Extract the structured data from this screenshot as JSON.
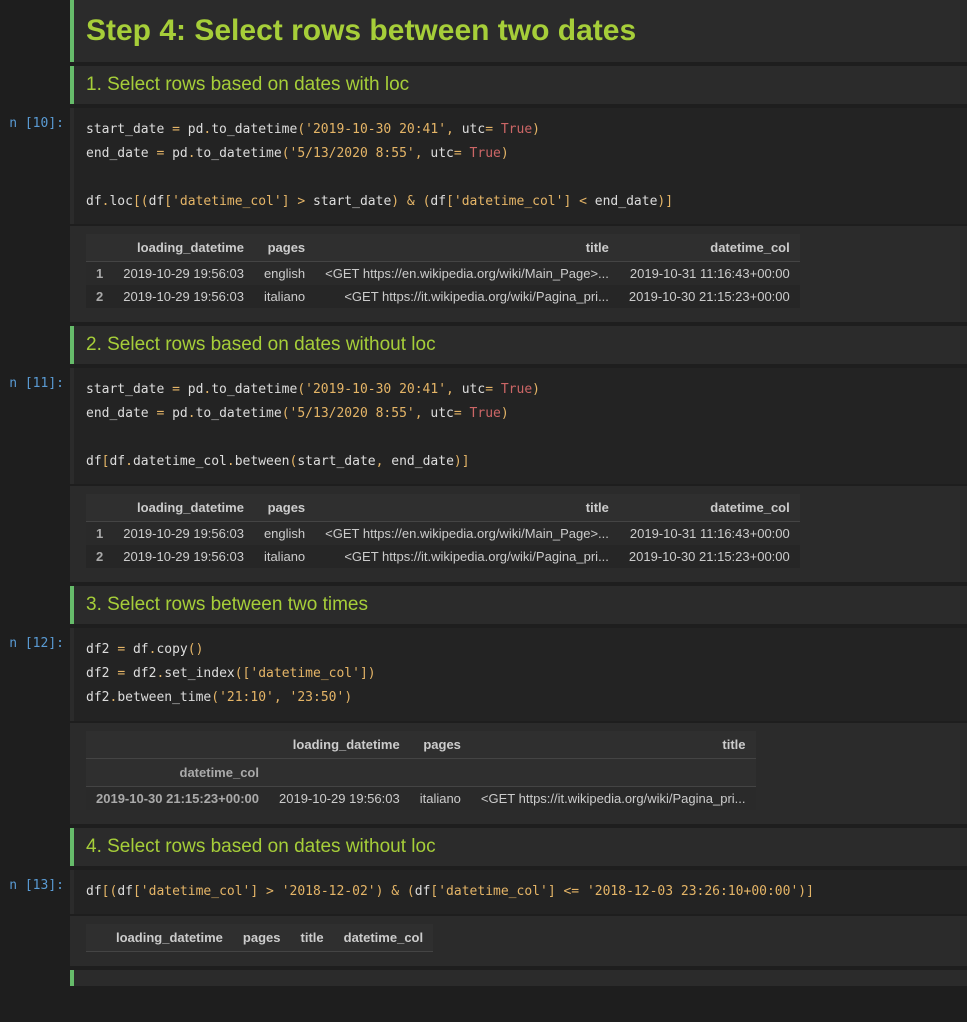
{
  "cells": [
    {
      "type": "md_h1",
      "text": "Step 4: Select rows between two dates"
    },
    {
      "type": "md_h3",
      "text": "1. Select rows based on dates with loc"
    },
    {
      "type": "code",
      "prompt": "n [10]:",
      "tokens": [
        [
          [
            "nm",
            "start_date "
          ],
          [
            "op",
            "="
          ],
          [
            "nm",
            " pd"
          ],
          [
            "op",
            "."
          ],
          [
            "nm",
            "to_datetime"
          ],
          [
            "op",
            "("
          ],
          [
            "str",
            "'2019-10-30 20:41'"
          ],
          [
            "op",
            ","
          ],
          [
            "nm",
            " utc"
          ],
          [
            "op",
            "= "
          ],
          [
            "key",
            "True"
          ],
          [
            "op",
            ")"
          ]
        ],
        [
          [
            "nm",
            "end_date "
          ],
          [
            "op",
            "="
          ],
          [
            "nm",
            " pd"
          ],
          [
            "op",
            "."
          ],
          [
            "nm",
            "to_datetime"
          ],
          [
            "op",
            "("
          ],
          [
            "str",
            "'5/13/2020 8:55'"
          ],
          [
            "op",
            ","
          ],
          [
            "nm",
            " utc"
          ],
          [
            "op",
            "= "
          ],
          [
            "key",
            "True"
          ],
          [
            "op",
            ")"
          ]
        ],
        [],
        [
          [
            "nm",
            "df"
          ],
          [
            "op",
            "."
          ],
          [
            "nm",
            "loc"
          ],
          [
            "op",
            "[("
          ],
          [
            "nm",
            "df"
          ],
          [
            "op",
            "["
          ],
          [
            "str",
            "'datetime_col'"
          ],
          [
            "op",
            "]"
          ],
          [
            "nm",
            " "
          ],
          [
            "op",
            ">"
          ],
          [
            "nm",
            " start_date"
          ],
          [
            "op",
            ")"
          ],
          [
            "nm",
            " "
          ],
          [
            "op",
            "&"
          ],
          [
            "nm",
            " "
          ],
          [
            "op",
            "("
          ],
          [
            "nm",
            "df"
          ],
          [
            "op",
            "["
          ],
          [
            "str",
            "'datetime_col'"
          ],
          [
            "op",
            "]"
          ],
          [
            "nm",
            " "
          ],
          [
            "op",
            "<"
          ],
          [
            "nm",
            " end_date"
          ],
          [
            "op",
            ")]"
          ]
        ]
      ],
      "output_table": {
        "index_name": "",
        "headers": [
          "loading_datetime",
          "pages",
          "title",
          "datetime_col"
        ],
        "rows": [
          {
            "idx": "1",
            "cells": [
              "2019-10-29 19:56:03",
              "english",
              "<GET https://en.wikipedia.org/wiki/Main_Page>...",
              "2019-10-31 11:16:43+00:00"
            ]
          },
          {
            "idx": "2",
            "cells": [
              "2019-10-29 19:56:03",
              "italiano",
              "<GET https://it.wikipedia.org/wiki/Pagina_pri...",
              "2019-10-30 21:15:23+00:00"
            ]
          }
        ]
      }
    },
    {
      "type": "md_h3",
      "text": "2. Select rows based on dates without loc"
    },
    {
      "type": "code",
      "prompt": "n [11]:",
      "tokens": [
        [
          [
            "nm",
            "start_date "
          ],
          [
            "op",
            "="
          ],
          [
            "nm",
            " pd"
          ],
          [
            "op",
            "."
          ],
          [
            "nm",
            "to_datetime"
          ],
          [
            "op",
            "("
          ],
          [
            "str",
            "'2019-10-30 20:41'"
          ],
          [
            "op",
            ","
          ],
          [
            "nm",
            " utc"
          ],
          [
            "op",
            "= "
          ],
          [
            "key",
            "True"
          ],
          [
            "op",
            ")"
          ]
        ],
        [
          [
            "nm",
            "end_date "
          ],
          [
            "op",
            "="
          ],
          [
            "nm",
            " pd"
          ],
          [
            "op",
            "."
          ],
          [
            "nm",
            "to_datetime"
          ],
          [
            "op",
            "("
          ],
          [
            "str",
            "'5/13/2020 8:55'"
          ],
          [
            "op",
            ","
          ],
          [
            "nm",
            " utc"
          ],
          [
            "op",
            "= "
          ],
          [
            "key",
            "True"
          ],
          [
            "op",
            ")"
          ]
        ],
        [],
        [
          [
            "nm",
            "df"
          ],
          [
            "op",
            "["
          ],
          [
            "nm",
            "df"
          ],
          [
            "op",
            "."
          ],
          [
            "nm",
            "datetime_col"
          ],
          [
            "op",
            "."
          ],
          [
            "nm",
            "between"
          ],
          [
            "op",
            "("
          ],
          [
            "nm",
            "start_date"
          ],
          [
            "op",
            ","
          ],
          [
            "nm",
            " end_date"
          ],
          [
            "op",
            ")"
          ],
          [
            "op",
            "]"
          ]
        ]
      ],
      "output_table": {
        "index_name": "",
        "headers": [
          "loading_datetime",
          "pages",
          "title",
          "datetime_col"
        ],
        "rows": [
          {
            "idx": "1",
            "cells": [
              "2019-10-29 19:56:03",
              "english",
              "<GET https://en.wikipedia.org/wiki/Main_Page>...",
              "2019-10-31 11:16:43+00:00"
            ]
          },
          {
            "idx": "2",
            "cells": [
              "2019-10-29 19:56:03",
              "italiano",
              "<GET https://it.wikipedia.org/wiki/Pagina_pri...",
              "2019-10-30 21:15:23+00:00"
            ]
          }
        ]
      }
    },
    {
      "type": "md_h3",
      "text": "3. Select rows between two times"
    },
    {
      "type": "code",
      "prompt": "n [12]:",
      "tokens": [
        [
          [
            "nm",
            "df2 "
          ],
          [
            "op",
            "="
          ],
          [
            "nm",
            " df"
          ],
          [
            "op",
            "."
          ],
          [
            "nm",
            "copy"
          ],
          [
            "op",
            "()"
          ]
        ],
        [
          [
            "nm",
            "df2 "
          ],
          [
            "op",
            "="
          ],
          [
            "nm",
            " df2"
          ],
          [
            "op",
            "."
          ],
          [
            "nm",
            "set_index"
          ],
          [
            "op",
            "(["
          ],
          [
            "str",
            "'datetime_col'"
          ],
          [
            "op",
            "])"
          ]
        ],
        [
          [
            "nm",
            "df2"
          ],
          [
            "op",
            "."
          ],
          [
            "nm",
            "between_time"
          ],
          [
            "op",
            "("
          ],
          [
            "str",
            "'21:10'"
          ],
          [
            "op",
            ","
          ],
          [
            "nm",
            " "
          ],
          [
            "str",
            "'23:50'"
          ],
          [
            "op",
            ")"
          ]
        ]
      ],
      "output_table": {
        "index_name": "datetime_col",
        "headers": [
          "loading_datetime",
          "pages",
          "title"
        ],
        "rows": [
          {
            "idx": "2019-10-30 21:15:23+00:00",
            "cells": [
              "2019-10-29 19:56:03",
              "italiano",
              "<GET https://it.wikipedia.org/wiki/Pagina_pri..."
            ]
          }
        ]
      }
    },
    {
      "type": "md_h3",
      "text": "4. Select rows based on dates without loc"
    },
    {
      "type": "code",
      "prompt": "n [13]:",
      "tokens": [
        [
          [
            "nm",
            "df"
          ],
          [
            "op",
            "[("
          ],
          [
            "nm",
            "df"
          ],
          [
            "op",
            "["
          ],
          [
            "str",
            "'datetime_col'"
          ],
          [
            "op",
            "]"
          ],
          [
            "nm",
            " "
          ],
          [
            "op",
            ">"
          ],
          [
            "nm",
            " "
          ],
          [
            "str",
            "'2018-12-02'"
          ],
          [
            "op",
            ")"
          ],
          [
            "nm",
            " "
          ],
          [
            "op",
            "&"
          ],
          [
            "nm",
            " "
          ],
          [
            "op",
            "("
          ],
          [
            "nm",
            "df"
          ],
          [
            "op",
            "["
          ],
          [
            "str",
            "'datetime_col'"
          ],
          [
            "op",
            "]"
          ],
          [
            "nm",
            " "
          ],
          [
            "op",
            "<="
          ],
          [
            "nm",
            " "
          ],
          [
            "str",
            "'2018-12-03 23:26:10+00:00'"
          ],
          [
            "op",
            ")"
          ],
          [
            "op",
            "]"
          ]
        ]
      ],
      "output_table": {
        "index_name": "",
        "headers": [
          "loading_datetime",
          "pages",
          "title",
          "datetime_col"
        ],
        "rows": []
      }
    },
    {
      "type": "md_h3",
      "text": ""
    }
  ]
}
